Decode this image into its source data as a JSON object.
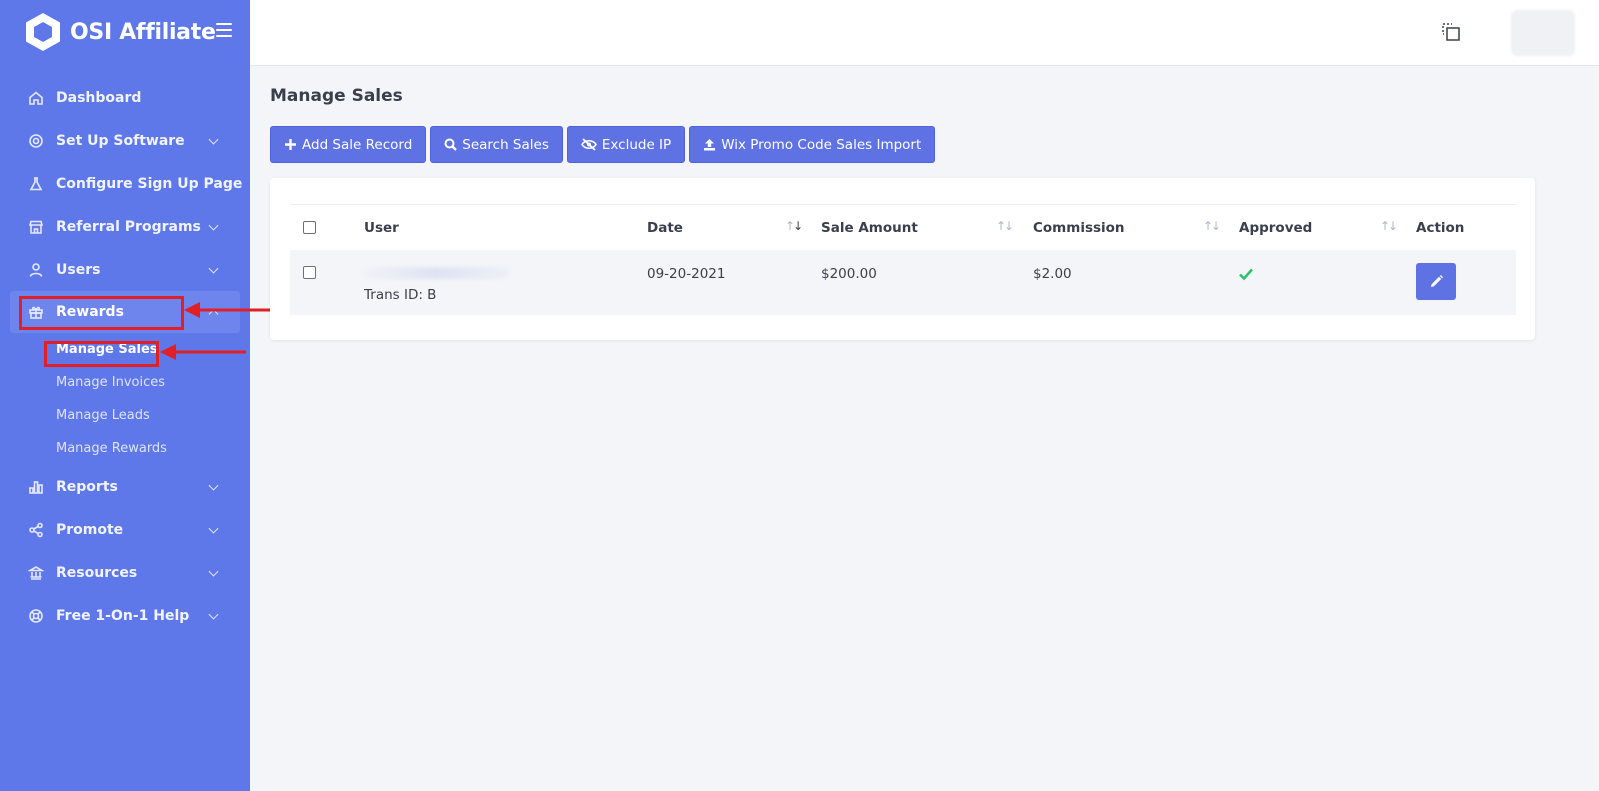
{
  "brand": {
    "name": "OSI Affiliate"
  },
  "sidebar": {
    "items": [
      {
        "label": "Dashboard",
        "icon": "home-icon",
        "has_submenu": false
      },
      {
        "label": "Set Up Software",
        "icon": "gear-icon",
        "has_submenu": true
      },
      {
        "label": "Configure Sign Up Page",
        "icon": "flask-icon",
        "has_submenu": false
      },
      {
        "label": "Referral Programs",
        "icon": "store-icon",
        "has_submenu": true
      },
      {
        "label": "Users",
        "icon": "user-icon",
        "has_submenu": true
      },
      {
        "label": "Rewards",
        "icon": "gift-icon",
        "has_submenu": true,
        "expanded": true
      },
      {
        "label": "Reports",
        "icon": "bar-chart-icon",
        "has_submenu": true
      },
      {
        "label": "Promote",
        "icon": "share-icon",
        "has_submenu": true
      },
      {
        "label": "Resources",
        "icon": "bank-icon",
        "has_submenu": true
      },
      {
        "label": "Free 1-On-1 Help",
        "icon": "lifebuoy-icon",
        "has_submenu": true
      }
    ],
    "rewards_sub": [
      {
        "label": "Manage Sales",
        "current": true
      },
      {
        "label": "Manage Invoices"
      },
      {
        "label": "Manage Leads"
      },
      {
        "label": "Manage Rewards"
      }
    ]
  },
  "page": {
    "title": "Manage Sales"
  },
  "toolbar": {
    "add_sale": "Add Sale Record",
    "search_sales": "Search Sales",
    "exclude_ip": "Exclude IP",
    "wix_import": "Wix Promo Code Sales Import"
  },
  "table": {
    "columns": [
      "User",
      "Date",
      "Sale Amount",
      "Commission",
      "Approved",
      "Action"
    ],
    "sorted_column": "Date",
    "rows": [
      {
        "user": "",
        "trans_id": "Trans ID: B",
        "date": "09-20-2021",
        "sale_amount": "$200.00",
        "commission": "$2.00",
        "approved": true
      }
    ]
  },
  "colors": {
    "sidebar": "#5e78ea",
    "primary_button": "#5e72e4",
    "highlight": "#e01f26",
    "approved": "#2fbf71"
  }
}
